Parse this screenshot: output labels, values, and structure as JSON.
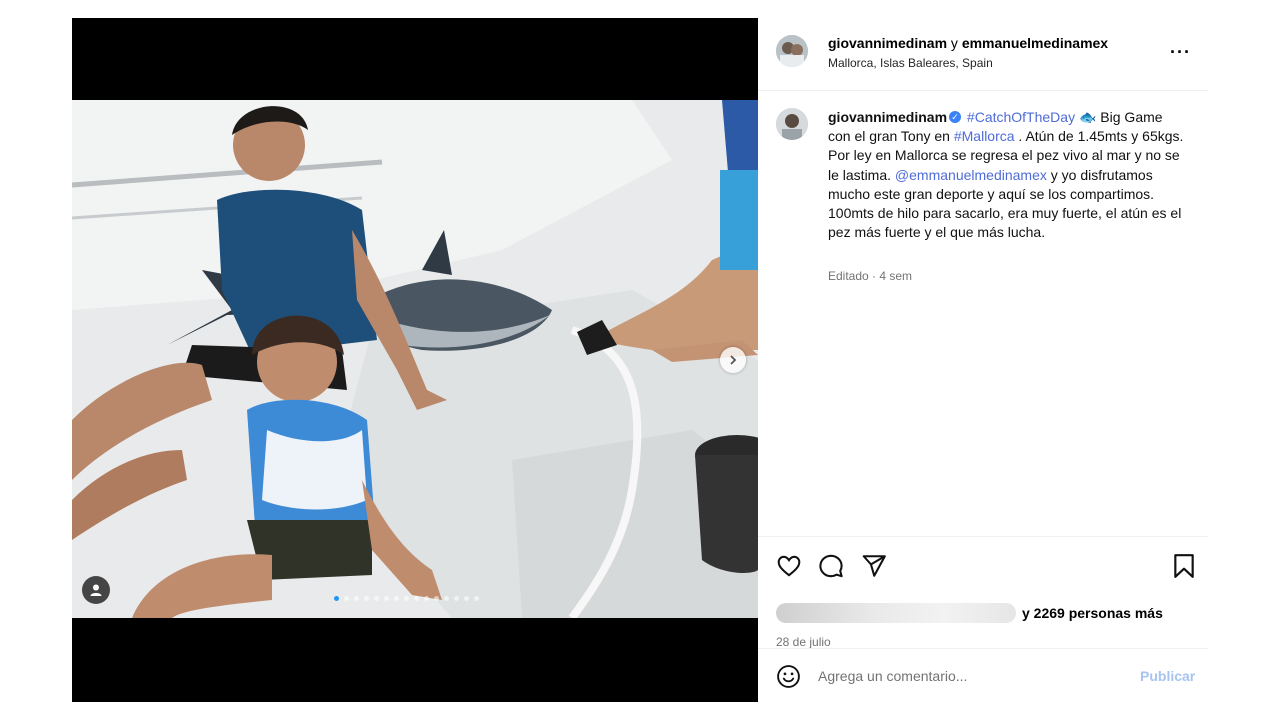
{
  "post": {
    "header": {
      "author1": "giovannimedinam",
      "connector": " y ",
      "author2": "emmanuelmedinamex",
      "location": "Mallorca, Islas Baleares, Spain",
      "more_icon": "more-horizontal-icon"
    },
    "caption": {
      "author": "giovannimedinam",
      "hashtag1": "#CatchOfTheDay",
      "fish_emoji": "🐟",
      "text1": " Big Game con el gran Tony en ",
      "hashtag2": "#Mallorca",
      "text2": " . Atún de 1.45mts y 65kgs. Por ley en Mallorca se regresa el pez vivo al mar y no se le lastima. ",
      "mention": "@emmanuelmedinamex",
      "text3": " y yo disfrutamos mucho este gran deporte y aquí se los compartimos. 100mts de hilo para sacarlo, era muy fuerte, el atún es el pez más fuerte y el que más lucha."
    },
    "meta": "Editado · 4 sem",
    "likes_text": "y 2269 personas más",
    "date": "28 de julio",
    "comment_placeholder": "Agrega un comentario...",
    "publish_label": "Publicar",
    "carousel": {
      "total": 15,
      "active_index": 0
    },
    "colors": {
      "link": "#4f6bd8",
      "publish": "#a7c4f0",
      "verified": "#3b82f6",
      "active_dot": "#2196f3"
    }
  }
}
